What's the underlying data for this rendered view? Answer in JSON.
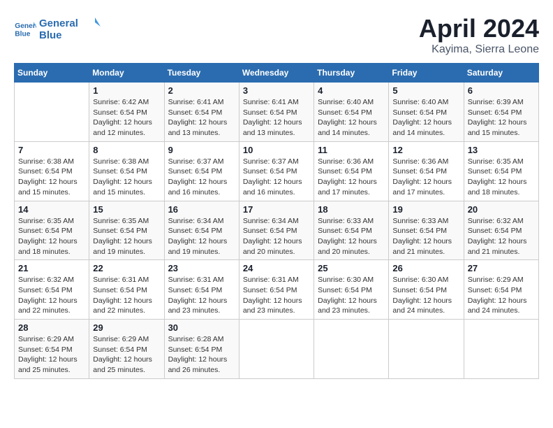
{
  "header": {
    "logo_line1": "General",
    "logo_line2": "Blue",
    "month_year": "April 2024",
    "location": "Kayima, Sierra Leone"
  },
  "weekdays": [
    "Sunday",
    "Monday",
    "Tuesday",
    "Wednesday",
    "Thursday",
    "Friday",
    "Saturday"
  ],
  "weeks": [
    [
      {
        "day": "",
        "info": ""
      },
      {
        "day": "1",
        "info": "Sunrise: 6:42 AM\nSunset: 6:54 PM\nDaylight: 12 hours\nand 12 minutes."
      },
      {
        "day": "2",
        "info": "Sunrise: 6:41 AM\nSunset: 6:54 PM\nDaylight: 12 hours\nand 13 minutes."
      },
      {
        "day": "3",
        "info": "Sunrise: 6:41 AM\nSunset: 6:54 PM\nDaylight: 12 hours\nand 13 minutes."
      },
      {
        "day": "4",
        "info": "Sunrise: 6:40 AM\nSunset: 6:54 PM\nDaylight: 12 hours\nand 14 minutes."
      },
      {
        "day": "5",
        "info": "Sunrise: 6:40 AM\nSunset: 6:54 PM\nDaylight: 12 hours\nand 14 minutes."
      },
      {
        "day": "6",
        "info": "Sunrise: 6:39 AM\nSunset: 6:54 PM\nDaylight: 12 hours\nand 15 minutes."
      }
    ],
    [
      {
        "day": "7",
        "info": "Sunrise: 6:38 AM\nSunset: 6:54 PM\nDaylight: 12 hours\nand 15 minutes."
      },
      {
        "day": "8",
        "info": "Sunrise: 6:38 AM\nSunset: 6:54 PM\nDaylight: 12 hours\nand 15 minutes."
      },
      {
        "day": "9",
        "info": "Sunrise: 6:37 AM\nSunset: 6:54 PM\nDaylight: 12 hours\nand 16 minutes."
      },
      {
        "day": "10",
        "info": "Sunrise: 6:37 AM\nSunset: 6:54 PM\nDaylight: 12 hours\nand 16 minutes."
      },
      {
        "day": "11",
        "info": "Sunrise: 6:36 AM\nSunset: 6:54 PM\nDaylight: 12 hours\nand 17 minutes."
      },
      {
        "day": "12",
        "info": "Sunrise: 6:36 AM\nSunset: 6:54 PM\nDaylight: 12 hours\nand 17 minutes."
      },
      {
        "day": "13",
        "info": "Sunrise: 6:35 AM\nSunset: 6:54 PM\nDaylight: 12 hours\nand 18 minutes."
      }
    ],
    [
      {
        "day": "14",
        "info": "Sunrise: 6:35 AM\nSunset: 6:54 PM\nDaylight: 12 hours\nand 18 minutes."
      },
      {
        "day": "15",
        "info": "Sunrise: 6:35 AM\nSunset: 6:54 PM\nDaylight: 12 hours\nand 19 minutes."
      },
      {
        "day": "16",
        "info": "Sunrise: 6:34 AM\nSunset: 6:54 PM\nDaylight: 12 hours\nand 19 minutes."
      },
      {
        "day": "17",
        "info": "Sunrise: 6:34 AM\nSunset: 6:54 PM\nDaylight: 12 hours\nand 20 minutes."
      },
      {
        "day": "18",
        "info": "Sunrise: 6:33 AM\nSunset: 6:54 PM\nDaylight: 12 hours\nand 20 minutes."
      },
      {
        "day": "19",
        "info": "Sunrise: 6:33 AM\nSunset: 6:54 PM\nDaylight: 12 hours\nand 21 minutes."
      },
      {
        "day": "20",
        "info": "Sunrise: 6:32 AM\nSunset: 6:54 PM\nDaylight: 12 hours\nand 21 minutes."
      }
    ],
    [
      {
        "day": "21",
        "info": "Sunrise: 6:32 AM\nSunset: 6:54 PM\nDaylight: 12 hours\nand 22 minutes."
      },
      {
        "day": "22",
        "info": "Sunrise: 6:31 AM\nSunset: 6:54 PM\nDaylight: 12 hours\nand 22 minutes."
      },
      {
        "day": "23",
        "info": "Sunrise: 6:31 AM\nSunset: 6:54 PM\nDaylight: 12 hours\nand 23 minutes."
      },
      {
        "day": "24",
        "info": "Sunrise: 6:31 AM\nSunset: 6:54 PM\nDaylight: 12 hours\nand 23 minutes."
      },
      {
        "day": "25",
        "info": "Sunrise: 6:30 AM\nSunset: 6:54 PM\nDaylight: 12 hours\nand 23 minutes."
      },
      {
        "day": "26",
        "info": "Sunrise: 6:30 AM\nSunset: 6:54 PM\nDaylight: 12 hours\nand 24 minutes."
      },
      {
        "day": "27",
        "info": "Sunrise: 6:29 AM\nSunset: 6:54 PM\nDaylight: 12 hours\nand 24 minutes."
      }
    ],
    [
      {
        "day": "28",
        "info": "Sunrise: 6:29 AM\nSunset: 6:54 PM\nDaylight: 12 hours\nand 25 minutes."
      },
      {
        "day": "29",
        "info": "Sunrise: 6:29 AM\nSunset: 6:54 PM\nDaylight: 12 hours\nand 25 minutes."
      },
      {
        "day": "30",
        "info": "Sunrise: 6:28 AM\nSunset: 6:54 PM\nDaylight: 12 hours\nand 26 minutes."
      },
      {
        "day": "",
        "info": ""
      },
      {
        "day": "",
        "info": ""
      },
      {
        "day": "",
        "info": ""
      },
      {
        "day": "",
        "info": ""
      }
    ]
  ]
}
